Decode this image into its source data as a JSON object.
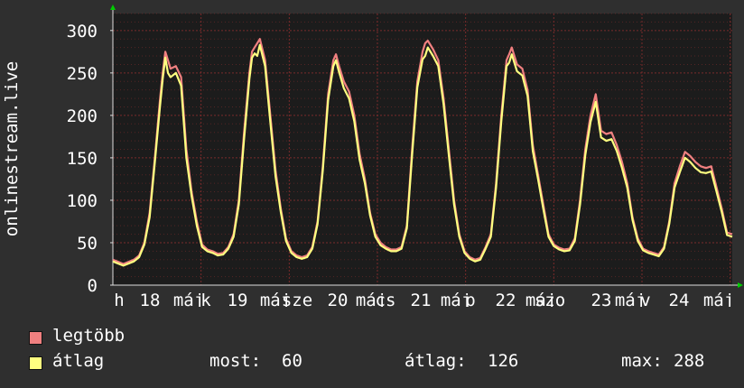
{
  "chart_data": {
    "type": "line",
    "ylabel": "onlinestream.live",
    "ylim": [
      0,
      320
    ],
    "y_ticks": [
      0,
      50,
      100,
      150,
      200,
      250,
      300
    ],
    "grid": true,
    "x_tick_labels": [
      "h",
      "18",
      "máj",
      "k",
      "19",
      "máj",
      "sze",
      "20",
      "máj",
      "cs",
      "21",
      "máj",
      "p",
      "22",
      "máj",
      "szo",
      "23",
      "máj",
      "v",
      "24",
      "máj"
    ],
    "background_color": "#2f2f2f",
    "plot_color": "#1c1c1c",
    "grid_color": "#7a2b2b",
    "axis_color": "#dddddd",
    "series": [
      {
        "name": "legtöbb",
        "color": "#f08080",
        "points": [
          [
            0,
            30
          ],
          [
            2,
            25
          ],
          [
            4,
            30
          ],
          [
            5,
            35
          ],
          [
            6,
            50
          ],
          [
            7,
            85
          ],
          [
            8,
            150
          ],
          [
            9,
            220
          ],
          [
            9.5,
            250
          ],
          [
            10,
            275
          ],
          [
            10.5,
            265
          ],
          [
            11,
            255
          ],
          [
            12,
            258
          ],
          [
            13,
            245
          ],
          [
            14,
            160
          ],
          [
            15,
            110
          ],
          [
            16,
            75
          ],
          [
            17,
            48
          ],
          [
            18,
            42
          ],
          [
            19,
            40
          ],
          [
            20,
            37
          ],
          [
            21,
            38
          ],
          [
            22,
            45
          ],
          [
            23,
            60
          ],
          [
            24,
            100
          ],
          [
            25,
            180
          ],
          [
            26,
            250
          ],
          [
            26.5,
            275
          ],
          [
            27,
            280
          ],
          [
            27.5,
            285
          ],
          [
            28,
            290
          ],
          [
            29,
            265
          ],
          [
            30,
            200
          ],
          [
            31,
            135
          ],
          [
            32,
            90
          ],
          [
            33,
            55
          ],
          [
            34,
            40
          ],
          [
            35,
            35
          ],
          [
            36,
            33
          ],
          [
            37,
            35
          ],
          [
            38,
            45
          ],
          [
            39,
            75
          ],
          [
            40,
            140
          ],
          [
            41,
            225
          ],
          [
            42,
            265
          ],
          [
            42.5,
            272
          ],
          [
            43,
            260
          ],
          [
            44,
            240
          ],
          [
            45,
            228
          ],
          [
            46,
            200
          ],
          [
            47,
            155
          ],
          [
            48,
            125
          ],
          [
            49,
            85
          ],
          [
            50,
            60
          ],
          [
            51,
            50
          ],
          [
            52,
            45
          ],
          [
            53,
            42
          ],
          [
            54,
            42
          ],
          [
            55,
            45
          ],
          [
            56,
            70
          ],
          [
            57,
            160
          ],
          [
            58,
            240
          ],
          [
            59,
            275
          ],
          [
            59.5,
            285
          ],
          [
            60,
            288
          ],
          [
            61,
            278
          ],
          [
            62,
            265
          ],
          [
            63,
            220
          ],
          [
            64,
            160
          ],
          [
            65,
            100
          ],
          [
            66,
            60
          ],
          [
            67,
            40
          ],
          [
            68,
            33
          ],
          [
            69,
            30
          ],
          [
            70,
            32
          ],
          [
            71,
            45
          ],
          [
            72,
            60
          ],
          [
            73,
            120
          ],
          [
            74,
            200
          ],
          [
            75,
            265
          ],
          [
            75.5,
            272
          ],
          [
            76,
            280
          ],
          [
            77,
            260
          ],
          [
            78,
            255
          ],
          [
            79,
            230
          ],
          [
            80,
            165
          ],
          [
            81,
            130
          ],
          [
            82,
            95
          ],
          [
            83,
            60
          ],
          [
            84,
            48
          ],
          [
            85,
            44
          ],
          [
            86,
            42
          ],
          [
            87,
            43
          ],
          [
            88,
            55
          ],
          [
            89,
            100
          ],
          [
            90,
            160
          ],
          [
            91,
            200
          ],
          [
            92,
            225
          ],
          [
            93,
            182
          ],
          [
            94,
            178
          ],
          [
            95,
            180
          ],
          [
            96,
            165
          ],
          [
            97,
            145
          ],
          [
            98,
            120
          ],
          [
            99,
            80
          ],
          [
            100,
            55
          ],
          [
            101,
            43
          ],
          [
            102,
            40
          ],
          [
            103,
            38
          ],
          [
            104,
            36
          ],
          [
            105,
            45
          ],
          [
            106,
            75
          ],
          [
            107,
            120
          ],
          [
            108,
            140
          ],
          [
            109,
            157
          ],
          [
            110,
            152
          ],
          [
            111,
            145
          ],
          [
            112,
            140
          ],
          [
            113,
            138
          ],
          [
            114,
            140
          ],
          [
            115,
            115
          ],
          [
            116,
            90
          ],
          [
            117,
            62
          ],
          [
            118,
            60
          ]
        ]
      },
      {
        "name": "átlag",
        "color": "#ffff80",
        "points": [
          [
            0,
            28
          ],
          [
            2,
            23
          ],
          [
            4,
            28
          ],
          [
            5,
            33
          ],
          [
            6,
            48
          ],
          [
            7,
            80
          ],
          [
            8,
            145
          ],
          [
            9,
            212
          ],
          [
            9.5,
            243
          ],
          [
            10,
            268
          ],
          [
            10.5,
            250
          ],
          [
            11,
            245
          ],
          [
            12,
            250
          ],
          [
            13,
            235
          ],
          [
            14,
            150
          ],
          [
            15,
            105
          ],
          [
            16,
            70
          ],
          [
            17,
            45
          ],
          [
            18,
            40
          ],
          [
            19,
            38
          ],
          [
            20,
            35
          ],
          [
            21,
            36
          ],
          [
            22,
            43
          ],
          [
            23,
            57
          ],
          [
            24,
            95
          ],
          [
            25,
            172
          ],
          [
            26,
            243
          ],
          [
            26.5,
            268
          ],
          [
            27,
            273
          ],
          [
            27.5,
            270
          ],
          [
            28,
            283
          ],
          [
            29,
            258
          ],
          [
            30,
            192
          ],
          [
            31,
            128
          ],
          [
            32,
            86
          ],
          [
            33,
            52
          ],
          [
            34,
            38
          ],
          [
            35,
            33
          ],
          [
            36,
            31
          ],
          [
            37,
            33
          ],
          [
            38,
            43
          ],
          [
            39,
            72
          ],
          [
            40,
            135
          ],
          [
            41,
            218
          ],
          [
            42,
            258
          ],
          [
            42.5,
            265
          ],
          [
            43,
            253
          ],
          [
            44,
            232
          ],
          [
            45,
            220
          ],
          [
            46,
            193
          ],
          [
            47,
            148
          ],
          [
            48,
            120
          ],
          [
            49,
            82
          ],
          [
            50,
            57
          ],
          [
            51,
            47
          ],
          [
            52,
            43
          ],
          [
            53,
            40
          ],
          [
            54,
            40
          ],
          [
            55,
            43
          ],
          [
            56,
            67
          ],
          [
            57,
            153
          ],
          [
            58,
            233
          ],
          [
            59,
            266
          ],
          [
            59.5,
            270
          ],
          [
            60,
            280
          ],
          [
            61,
            270
          ],
          [
            62,
            258
          ],
          [
            63,
            213
          ],
          [
            64,
            153
          ],
          [
            65,
            95
          ],
          [
            66,
            57
          ],
          [
            67,
            38
          ],
          [
            68,
            31
          ],
          [
            69,
            28
          ],
          [
            70,
            30
          ],
          [
            71,
            43
          ],
          [
            72,
            57
          ],
          [
            73,
            115
          ],
          [
            74,
            193
          ],
          [
            75,
            258
          ],
          [
            75.5,
            262
          ],
          [
            76,
            272
          ],
          [
            77,
            252
          ],
          [
            78,
            247
          ],
          [
            79,
            223
          ],
          [
            80,
            158
          ],
          [
            81,
            125
          ],
          [
            82,
            90
          ],
          [
            83,
            57
          ],
          [
            84,
            46
          ],
          [
            85,
            42
          ],
          [
            86,
            40
          ],
          [
            87,
            41
          ],
          [
            88,
            52
          ],
          [
            89,
            95
          ],
          [
            90,
            153
          ],
          [
            91,
            192
          ],
          [
            92,
            216
          ],
          [
            93,
            174
          ],
          [
            94,
            170
          ],
          [
            95,
            172
          ],
          [
            96,
            158
          ],
          [
            97,
            138
          ],
          [
            98,
            115
          ],
          [
            99,
            77
          ],
          [
            100,
            52
          ],
          [
            101,
            41
          ],
          [
            102,
            38
          ],
          [
            103,
            36
          ],
          [
            104,
            34
          ],
          [
            105,
            43
          ],
          [
            106,
            72
          ],
          [
            107,
            115
          ],
          [
            108,
            133
          ],
          [
            109,
            150
          ],
          [
            110,
            145
          ],
          [
            111,
            138
          ],
          [
            112,
            133
          ],
          [
            113,
            132
          ],
          [
            114,
            134
          ],
          [
            115,
            110
          ],
          [
            116,
            86
          ],
          [
            117,
            59
          ],
          [
            118,
            57
          ]
        ]
      }
    ],
    "stats": {
      "now_label": "most:",
      "now_value": "60",
      "avg_label": "átlag:",
      "avg_value": "126",
      "max_label": "max:",
      "max_value": "288"
    }
  }
}
